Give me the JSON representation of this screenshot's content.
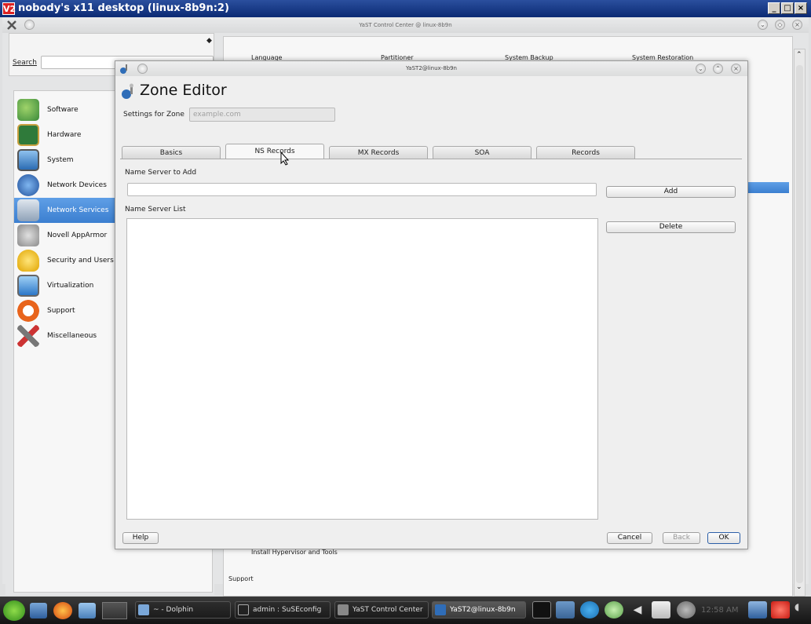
{
  "vnc": {
    "title": "nobody's x11 desktop (linux-8b9n:2)",
    "logo": "V2",
    "buttons": [
      "_",
      "□",
      "×"
    ]
  },
  "control_center": {
    "title": "YaST Control Center @ linux-8b9n",
    "search_label": "Search",
    "search_value": "",
    "categories": [
      {
        "label": "Software",
        "icon": "software-icon"
      },
      {
        "label": "Hardware",
        "icon": "hardware-icon"
      },
      {
        "label": "System",
        "icon": "system-icon"
      },
      {
        "label": "Network Devices",
        "icon": "network-devices-icon"
      },
      {
        "label": "Network Services",
        "icon": "network-services-icon",
        "selected": true
      },
      {
        "label": "Novell AppArmor",
        "icon": "apparmor-icon"
      },
      {
        "label": "Security and Users",
        "icon": "security-icon"
      },
      {
        "label": "Virtualization",
        "icon": "virtualization-icon"
      },
      {
        "label": "Support",
        "icon": "support-icon"
      },
      {
        "label": "Miscellaneous",
        "icon": "miscellaneous-icon"
      }
    ],
    "modules_partial": [
      "Language",
      "Partitioner",
      "System Backup",
      "System Restoration",
      "Install Hypervisor and Tools",
      "Support"
    ]
  },
  "dialog": {
    "window_title": "YaST2@linux-8b9n",
    "heading": "Zone Editor",
    "settings_label": "Settings for Zone",
    "zone_value": "example.com",
    "tabs": [
      {
        "label": "Basics"
      },
      {
        "label": "NS Records",
        "active": true
      },
      {
        "label": "MX Records"
      },
      {
        "label": "SOA"
      },
      {
        "label": "Records"
      }
    ],
    "ns_to_add_label": "Name Server to Add",
    "ns_to_add_value": "",
    "ns_list_label": "Name Server List",
    "ns_list": [],
    "add_button": "Add",
    "delete_button": "Delete",
    "help_button": "Help",
    "cancel_button": "Cancel",
    "back_button": "Back",
    "ok_button": "OK"
  },
  "taskbar": {
    "tasks": [
      {
        "label": "~ - Dolphin"
      },
      {
        "label": "admin : SuSEconfig"
      },
      {
        "label": "YaST Control Center"
      },
      {
        "label": "YaST2@linux-8b9n",
        "active": true
      }
    ],
    "clock": "12:58 AM"
  }
}
